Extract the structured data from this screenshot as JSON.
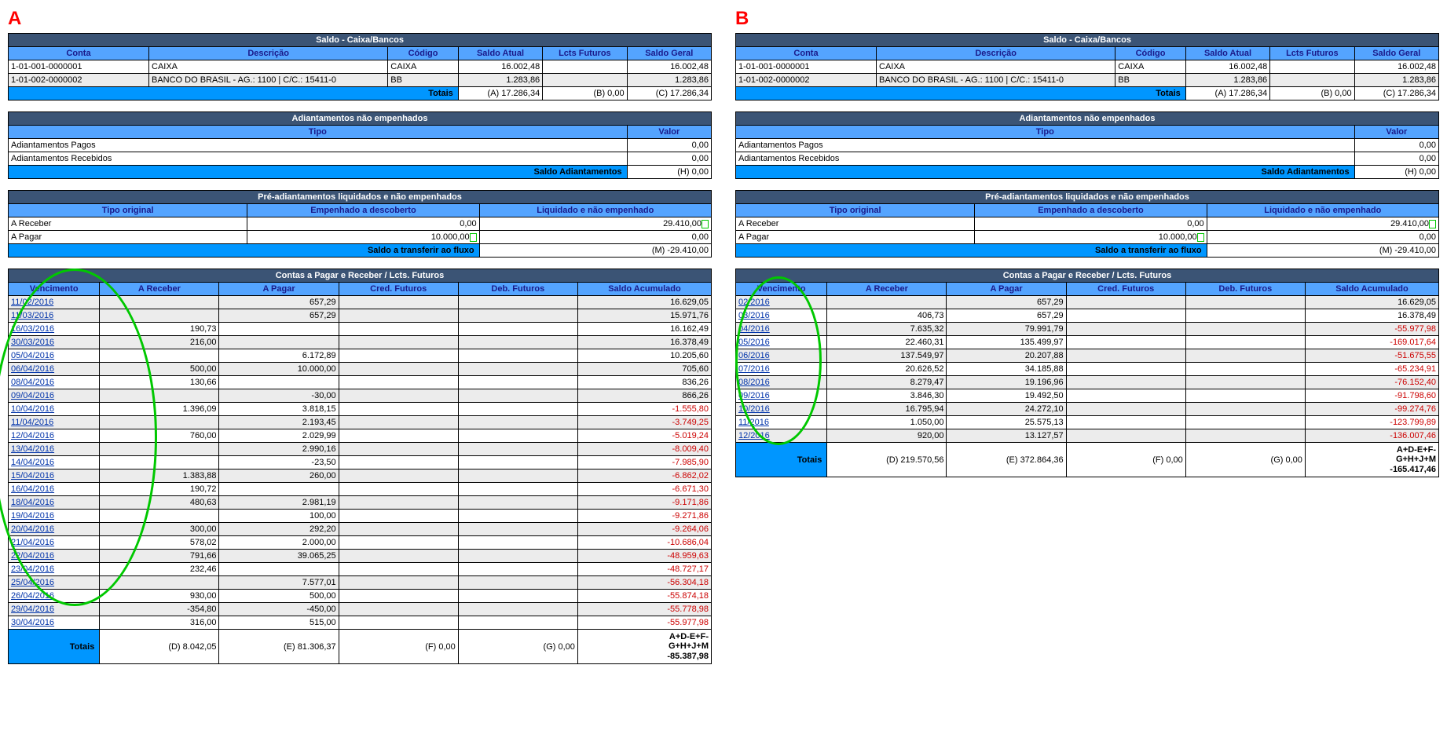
{
  "panels": {
    "A": {
      "label": "A"
    },
    "B": {
      "label": "B"
    }
  },
  "saldo": {
    "title": "Saldo - Caixa/Bancos",
    "headers": {
      "conta": "Conta",
      "descricao": "Descrição",
      "codigo": "Código",
      "satual": "Saldo Atual",
      "lcts": "Lcts Futuros",
      "sgeral": "Saldo Geral"
    },
    "rows": [
      {
        "conta": "1-01-001-0000001",
        "desc": "CAIXA",
        "cod": "CAIXA",
        "satual": "16.002,48",
        "lcts": "",
        "sgeral": "16.002,48"
      },
      {
        "conta": "1-01-002-0000002",
        "desc": "BANCO DO BRASIL - AG.: 1100 | C/C.: 15411-0",
        "cod": "BB",
        "satual": "1.283,86",
        "lcts": "",
        "sgeral": "1.283,86"
      }
    ],
    "totais": {
      "label": "Totais",
      "a": "(A) 17.286,34",
      "b": "(B) 0,00",
      "c": "(C) 17.286,34"
    }
  },
  "adiant": {
    "title": "Adiantamentos não empenhados",
    "headers": {
      "tipo": "Tipo",
      "valor": "Valor"
    },
    "rows": [
      {
        "tipo": "Adiantamentos Pagos",
        "valor": "0,00"
      },
      {
        "tipo": "Adiantamentos Recebidos",
        "valor": "0,00"
      }
    ],
    "totais": {
      "label": "Saldo Adiantamentos",
      "val": "(H) 0,00"
    }
  },
  "pre": {
    "title": "Pré-adiantamentos liquidados e não empenhados",
    "headers": {
      "tipo": "Tipo original",
      "emp": "Empenhado a descoberto",
      "liq": "Liquidado e não empenhado"
    },
    "rows": [
      {
        "tipo": "A Receber",
        "emp": "0,00",
        "liq": "29.410,00",
        "gb": true
      },
      {
        "tipo": "A Pagar",
        "emp": "10.000,00",
        "liq": "0,00",
        "gbEmp": true
      }
    ],
    "totais": {
      "label": "Saldo a transferir ao fluxo",
      "val": "(M) -29.410,00"
    }
  },
  "contas": {
    "title": "Contas a Pagar e Receber / Lcts. Futuros",
    "headers": {
      "venc": "Vencimento",
      "rec": "A Receber",
      "pag": "A Pagar",
      "cred": "Cred. Futuros",
      "deb": "Deb. Futuros",
      "sal": "Saldo Acumulado"
    },
    "A": {
      "rows": [
        {
          "venc": "11/02/2016",
          "rec": "",
          "pag": "657,29",
          "sal": "16.629,05",
          "alt": 1
        },
        {
          "venc": "11/03/2016",
          "rec": "",
          "pag": "657,29",
          "sal": "15.971,76",
          "alt": 1
        },
        {
          "venc": "16/03/2016",
          "rec": "190,73",
          "pag": "",
          "sal": "16.162,49"
        },
        {
          "venc": "30/03/2016",
          "rec": "216,00",
          "pag": "",
          "sal": "16.378,49",
          "alt": 1
        },
        {
          "venc": "05/04/2016",
          "rec": "",
          "pag": "6.172,89",
          "sal": "10.205,60"
        },
        {
          "venc": "06/04/2016",
          "rec": "500,00",
          "pag": "10.000,00",
          "sal": "705,60",
          "alt": 1
        },
        {
          "venc": "08/04/2016",
          "rec": "130,66",
          "pag": "",
          "sal": "836,26"
        },
        {
          "venc": "09/04/2016",
          "rec": "",
          "pag": "-30,00",
          "sal": "866,26",
          "alt": 1
        },
        {
          "venc": "10/04/2016",
          "rec": "1.396,09",
          "pag": "3.818,15",
          "sal": "-1.555,80",
          "neg": 1
        },
        {
          "venc": "11/04/2016",
          "rec": "",
          "pag": "2.193,45",
          "sal": "-3.749,25",
          "neg": 1,
          "alt": 1
        },
        {
          "venc": "12/04/2016",
          "rec": "760,00",
          "pag": "2.029,99",
          "sal": "-5.019,24",
          "neg": 1
        },
        {
          "venc": "13/04/2016",
          "rec": "",
          "pag": "2.990,16",
          "sal": "-8.009,40",
          "neg": 1,
          "alt": 1
        },
        {
          "venc": "14/04/2016",
          "rec": "",
          "pag": "-23,50",
          "sal": "-7.985,90",
          "neg": 1
        },
        {
          "venc": "15/04/2016",
          "rec": "1.383,88",
          "pag": "260,00",
          "sal": "-6.862,02",
          "neg": 1,
          "alt": 1
        },
        {
          "venc": "16/04/2016",
          "rec": "190,72",
          "pag": "",
          "sal": "-6.671,30",
          "neg": 1
        },
        {
          "venc": "18/04/2016",
          "rec": "480,63",
          "pag": "2.981,19",
          "sal": "-9.171,86",
          "neg": 1,
          "alt": 1
        },
        {
          "venc": "19/04/2016",
          "rec": "",
          "pag": "100,00",
          "sal": "-9.271,86",
          "neg": 1
        },
        {
          "venc": "20/04/2016",
          "rec": "300,00",
          "pag": "292,20",
          "sal": "-9.264,06",
          "neg": 1,
          "alt": 1
        },
        {
          "venc": "21/04/2016",
          "rec": "578,02",
          "pag": "2.000,00",
          "sal": "-10.686,04",
          "neg": 1
        },
        {
          "venc": "22/04/2016",
          "rec": "791,66",
          "pag": "39.065,25",
          "sal": "-48.959,63",
          "neg": 1,
          "alt": 1
        },
        {
          "venc": "23/04/2016",
          "rec": "232,46",
          "pag": "",
          "sal": "-48.727,17",
          "neg": 1
        },
        {
          "venc": "25/04/2016",
          "rec": "",
          "pag": "7.577,01",
          "sal": "-56.304,18",
          "neg": 1,
          "alt": 1
        },
        {
          "venc": "26/04/2016",
          "rec": "930,00",
          "pag": "500,00",
          "sal": "-55.874,18",
          "neg": 1
        },
        {
          "venc": "29/04/2016",
          "rec": "-354,80",
          "pag": "-450,00",
          "sal": "-55.778,98",
          "neg": 1,
          "alt": 1
        },
        {
          "venc": "30/04/2016",
          "rec": "316,00",
          "pag": "515,00",
          "sal": "-55.977,98",
          "neg": 1
        }
      ],
      "totais": {
        "label": "Totais",
        "d": "(D)  8.042,05",
        "e": "(E)  81.306,37",
        "f": "(F)  0,00",
        "g": "(G)  0,00",
        "sum1": "A+D-E+F-",
        "sum2": "G+H+J+M",
        "sum3": "-85.387,98"
      }
    },
    "B": {
      "rows": [
        {
          "venc": "02/2016",
          "rec": "",
          "pag": "657,29",
          "sal": "16.629,05",
          "alt": 1
        },
        {
          "venc": "03/2016",
          "rec": "406,73",
          "pag": "657,29",
          "sal": "16.378,49"
        },
        {
          "venc": "04/2016",
          "rec": "7.635,32",
          "pag": "79.991,79",
          "sal": "-55.977,98",
          "neg": 1,
          "alt": 1
        },
        {
          "venc": "05/2016",
          "rec": "22.460,31",
          "pag": "135.499,97",
          "sal": "-169.017,64",
          "neg": 1
        },
        {
          "venc": "06/2016",
          "rec": "137.549,97",
          "pag": "20.207,88",
          "sal": "-51.675,55",
          "neg": 1,
          "alt": 1
        },
        {
          "venc": "07/2016",
          "rec": "20.626,52",
          "pag": "34.185,88",
          "sal": "-65.234,91",
          "neg": 1
        },
        {
          "venc": "08/2016",
          "rec": "8.279,47",
          "pag": "19.196,96",
          "sal": "-76.152,40",
          "neg": 1,
          "alt": 1
        },
        {
          "venc": "09/2016",
          "rec": "3.846,30",
          "pag": "19.492,50",
          "sal": "-91.798,60",
          "neg": 1
        },
        {
          "venc": "10/2016",
          "rec": "16.795,94",
          "pag": "24.272,10",
          "sal": "-99.274,76",
          "neg": 1,
          "alt": 1
        },
        {
          "venc": "11/2016",
          "rec": "1.050,00",
          "pag": "25.575,13",
          "sal": "-123.799,89",
          "neg": 1
        },
        {
          "venc": "12/2016",
          "rec": "920,00",
          "pag": "13.127,57",
          "sal": "-136.007,46",
          "neg": 1,
          "alt": 1
        }
      ],
      "totais": {
        "label": "Totais",
        "d": "(D)  219.570,56",
        "e": "(E)  372.864,36",
        "f": "(F)  0,00",
        "g": "(G)  0,00",
        "sum1": "A+D-E+F-",
        "sum2": "G+H+J+M",
        "sum3": "-165.417,46"
      }
    }
  }
}
